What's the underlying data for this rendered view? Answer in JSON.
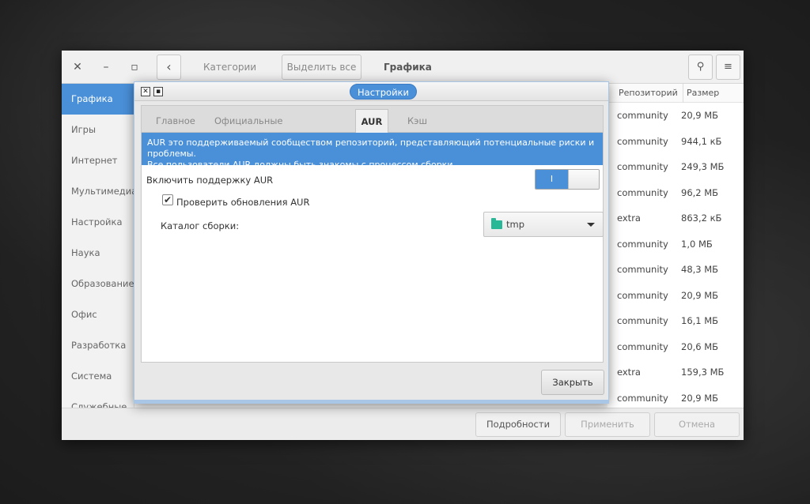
{
  "main": {
    "window_controls": {
      "close": "✕",
      "minimize": "–",
      "maximize": "▫"
    },
    "header": {
      "back_glyph": "‹",
      "categories_label": "Категории",
      "select_all_label": "Выделить все",
      "title": "Графика",
      "search_glyph": "⚲",
      "menu_glyph": "≡"
    },
    "sidebar": {
      "items": [
        {
          "label": "Графика"
        },
        {
          "label": "Игры"
        },
        {
          "label": "Интернет"
        },
        {
          "label": "Мультимедиа"
        },
        {
          "label": "Настройка"
        },
        {
          "label": "Наука"
        },
        {
          "label": "Образование"
        },
        {
          "label": "Офис"
        },
        {
          "label": "Разработка"
        },
        {
          "label": "Система"
        },
        {
          "label": "Служебные"
        }
      ],
      "active_index": 0
    },
    "table": {
      "headers": {
        "repo": "Репозиторий",
        "size": "Размер"
      },
      "rows": [
        {
          "repo": "community",
          "size": "20,9 МБ"
        },
        {
          "repo": "community",
          "size": "944,1 кБ"
        },
        {
          "repo": "community",
          "size": "249,3 МБ"
        },
        {
          "repo": "community",
          "size": "96,2 МБ"
        },
        {
          "repo": "extra",
          "size": "863,2 кБ"
        },
        {
          "repo": "community",
          "size": "1,0 МБ"
        },
        {
          "repo": "community",
          "size": "48,3 МБ"
        },
        {
          "repo": "community",
          "size": "20,9 МБ"
        },
        {
          "repo": "community",
          "size": "16,1 МБ"
        },
        {
          "repo": "community",
          "size": "20,6 МБ"
        },
        {
          "repo": "extra",
          "size": "159,3 МБ"
        },
        {
          "repo": "community",
          "size": "20,9 МБ"
        }
      ]
    },
    "bottom": {
      "details_label": "Подробности",
      "apply_label": "Применить",
      "cancel_label": "Отмена"
    }
  },
  "dialog": {
    "title": "Настройки",
    "tabs": [
      {
        "label": "Главное"
      },
      {
        "label": "Официальные репозитории"
      },
      {
        "label": "AUR"
      },
      {
        "label": "Кэш"
      }
    ],
    "active_tab": 2,
    "info_line1": "AUR это поддерживаемый сообществом репозиторий, представляющий потенциальные риски и проблемы.",
    "info_line2": "Все пользователи AUR должны быть знакомы с процессом сборки.",
    "enable_aur_label": "Включить поддержку AUR",
    "toggle_on_text": "I",
    "toggle_state": "on",
    "check_updates_label": "Проверить обновления AUR",
    "check_updates_checked": true,
    "build_dir_label": "Каталог сборки:",
    "build_dir_value": "tmp",
    "close_label": "Закрыть"
  },
  "colors": {
    "accent": "#4a90d9",
    "folder": "#28b898"
  }
}
